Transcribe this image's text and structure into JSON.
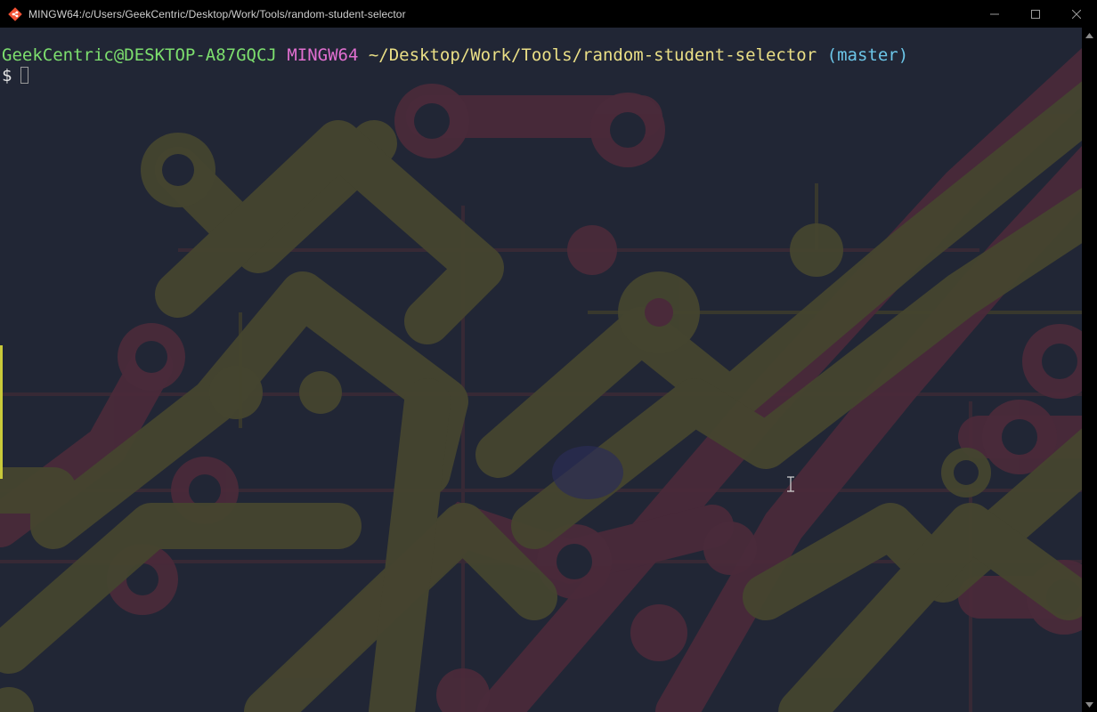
{
  "window": {
    "title": "MINGW64:/c/Users/GeekCentric/Desktop/Work/Tools/random-student-selector",
    "app_icon": "git-bash-icon",
    "controls": {
      "minimize_icon": "minimize-icon",
      "maximize_icon": "maximize-icon",
      "close_icon": "close-icon"
    }
  },
  "terminal": {
    "prompt": {
      "user_host": "GeekCentric@DESKTOP-A87GQCJ",
      "environment": "MINGW64",
      "path": "~/Desktop/Work/Tools/random-student-selector",
      "branch": "(master)"
    },
    "input_symbol": "$",
    "current_input": ""
  },
  "colors": {
    "background": "#212635",
    "user_host": "#7ddf6e",
    "environment": "#e16fd0",
    "path": "#eadf86",
    "branch": "#6cc6e8",
    "title_bar": "#000000",
    "circuit_olive": "#4a4a35",
    "circuit_maroon": "#4a2c3c"
  },
  "scrollbar": {
    "up_icon": "scroll-up-arrow-icon",
    "down_icon": "scroll-down-arrow-icon"
  }
}
